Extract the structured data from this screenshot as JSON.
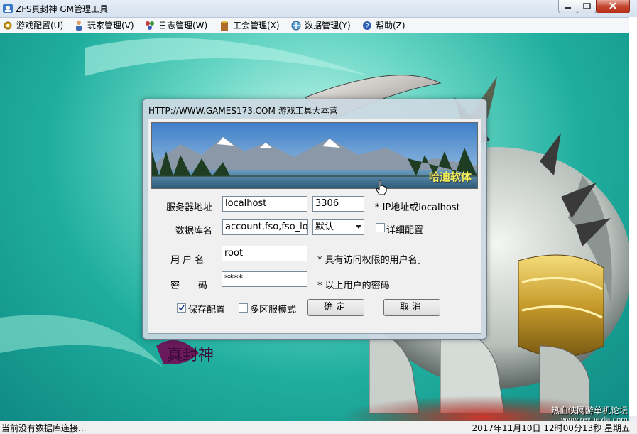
{
  "window": {
    "title": "ZFS真封神 GM管理工具"
  },
  "menu": [
    {
      "label": "游戏配置(U)",
      "icon": "gear-icon"
    },
    {
      "label": "玩家管理(V)",
      "icon": "player-icon"
    },
    {
      "label": "日志管理(W)",
      "icon": "log-icon"
    },
    {
      "label": "工会管理(X)",
      "icon": "guild-icon"
    },
    {
      "label": "数据管理(Y)",
      "icon": "data-icon"
    },
    {
      "label": "帮助(Z)",
      "icon": "help-icon"
    }
  ],
  "dialog": {
    "title": "HTTP://WWW.GAMES173.COM  游戏工具大本营",
    "banner_brand": "哈迪软体",
    "server_label": "服务器地址",
    "server_value": "localhost",
    "port_value": "3306",
    "server_hint": "* IP地址或localhost",
    "db_label": "数据库名",
    "db_value": "account,fso,fso_log",
    "db_select_value": "默认",
    "detail_label": "详细配置",
    "detail_checked": false,
    "user_label": "用 户 名",
    "user_value": "root",
    "user_hint": "* 具有访问权限的用户名。",
    "password_label": "密　　码",
    "password_value": "****",
    "password_hint": "* 以上用户的密码",
    "save_label": "保存配置",
    "save_checked": true,
    "multi_label": "多区服模式",
    "multi_checked": false,
    "ok_label": "确定",
    "cancel_label": "取消"
  },
  "status": {
    "left": "当前没有数据库连接...",
    "datetime": "2017年11月10日  12时00分13秒  星期五"
  },
  "watermark": {
    "line1": "热血侠网游单机论坛",
    "line2": "www.rexuexia.com"
  }
}
